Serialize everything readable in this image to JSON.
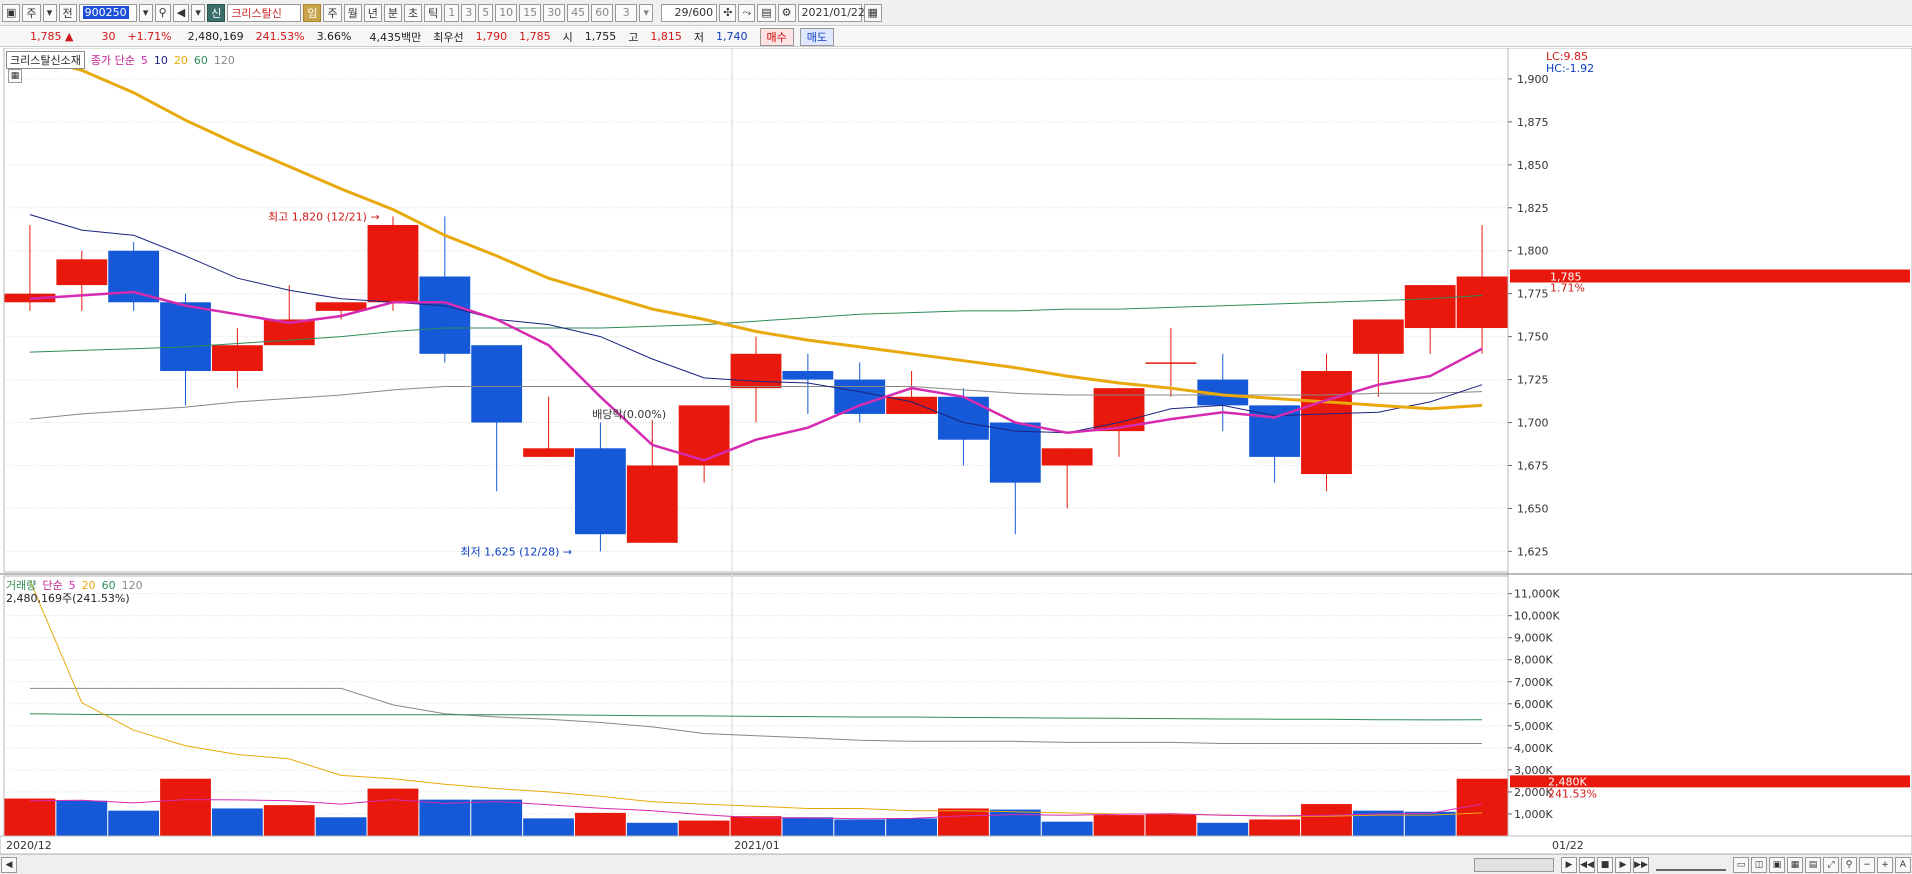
{
  "toolbar": {
    "market": "주",
    "scope": "전",
    "code": "900250",
    "symbol_badge": "신",
    "stock_name": "크리스탈신",
    "badge_gold": "임",
    "periods": [
      "주",
      "월",
      "년",
      "분",
      "초",
      "틱"
    ],
    "minutes": [
      "1",
      "3",
      "5",
      "10",
      "15",
      "30",
      "45",
      "60"
    ],
    "interval": "3",
    "count": "29/600",
    "date": "2021/01/22"
  },
  "quote": {
    "price": "1,785 ▲",
    "change": "30",
    "change_pct": "+1.71%",
    "volume": "2,480,169",
    "volume_pct": "241.53%",
    "turnover": "3.66%",
    "amount": "4,435백만",
    "best_label": "최우선",
    "best_ask": "1,790",
    "best_bid": "1,785",
    "open_label": "시",
    "open": "1,755",
    "high_label": "고",
    "high": "1,815",
    "low_label": "저",
    "low": "1,740",
    "buy_label": "매수",
    "sell_label": "매도"
  },
  "colors": {
    "up": "#e8180c",
    "down": "#1559d8",
    "ma5": "#d62bb0",
    "ma10": "#1a237e",
    "ma20": "#e8a90c",
    "ma60": "#2e8b57",
    "ma120": "#888888",
    "grid": "#dcdcdc",
    "axis_bg": "#ffffff"
  },
  "chart_data": [
    {
      "type": "candlestick",
      "legend": {
        "name": "크리스탈신소재",
        "ma_label": "종가 단순",
        "periods": [
          "5",
          "10",
          "20",
          "60",
          "120"
        ]
      },
      "y_ticks": [
        "1,900",
        "1,875",
        "1,850",
        "1,825",
        "1,800",
        "1,775",
        "1,750",
        "1,725",
        "1,700",
        "1,675",
        "1,650",
        "1,625"
      ],
      "ylim": [
        1613,
        1918
      ],
      "axis_labels": {
        "lc": "LC:9.85",
        "hc": "HC:-1.92",
        "current": "1,785",
        "current_pct": "1.71%"
      },
      "annotations": {
        "high": "최고 1,820 (12/21) →",
        "low": "최저 1,625 (12/28) →",
        "dividend": "배당락(0.00%)"
      },
      "x_labels": [
        "2020/12",
        "2021/01",
        "01/22"
      ],
      "candles": [
        {
          "o": 1770,
          "h": 1815,
          "l": 1765,
          "c": 1775
        },
        {
          "o": 1780,
          "h": 1800,
          "l": 1765,
          "c": 1795
        },
        {
          "o": 1800,
          "h": 1805,
          "l": 1765,
          "c": 1770
        },
        {
          "o": 1770,
          "h": 1775,
          "l": 1710,
          "c": 1730
        },
        {
          "o": 1730,
          "h": 1755,
          "l": 1720,
          "c": 1745
        },
        {
          "o": 1745,
          "h": 1780,
          "l": 1745,
          "c": 1760
        },
        {
          "o": 1765,
          "h": 1770,
          "l": 1760,
          "c": 1770
        },
        {
          "o": 1770,
          "h": 1820,
          "l": 1765,
          "c": 1815
        },
        {
          "o": 1785,
          "h": 1820,
          "l": 1735,
          "c": 1740
        },
        {
          "o": 1745,
          "h": 1745,
          "l": 1660,
          "c": 1700
        },
        {
          "o": 1680,
          "h": 1715,
          "l": 1680,
          "c": 1685
        },
        {
          "o": 1685,
          "h": 1700,
          "l": 1625,
          "c": 1635
        },
        {
          "o": 1630,
          "h": 1690,
          "l": 1630,
          "c": 1675
        },
        {
          "o": 1675,
          "h": 1710,
          "l": 1665,
          "c": 1710
        },
        {
          "o": 1720,
          "h": 1750,
          "l": 1700,
          "c": 1740
        },
        {
          "o": 1730,
          "h": 1740,
          "l": 1705,
          "c": 1725
        },
        {
          "o": 1725,
          "h": 1735,
          "l": 1700,
          "c": 1705
        },
        {
          "o": 1705,
          "h": 1730,
          "l": 1705,
          "c": 1715
        },
        {
          "o": 1715,
          "h": 1720,
          "l": 1675,
          "c": 1690
        },
        {
          "o": 1700,
          "h": 1700,
          "l": 1635,
          "c": 1665
        },
        {
          "o": 1675,
          "h": 1685,
          "l": 1650,
          "c": 1685
        },
        {
          "o": 1695,
          "h": 1720,
          "l": 1680,
          "c": 1720
        },
        {
          "o": 1735,
          "h": 1755,
          "l": 1715,
          "c": 1735
        },
        {
          "o": 1725,
          "h": 1740,
          "l": 1695,
          "c": 1710
        },
        {
          "o": 1710,
          "h": 1710,
          "l": 1665,
          "c": 1680
        },
        {
          "o": 1670,
          "h": 1740,
          "l": 1660,
          "c": 1730
        },
        {
          "o": 1740,
          "h": 1760,
          "l": 1715,
          "c": 1760
        },
        {
          "o": 1755,
          "h": 1780,
          "l": 1740,
          "c": 1780
        },
        {
          "o": 1755,
          "h": 1815,
          "l": 1740,
          "c": 1785
        }
      ],
      "ma5": [
        1772,
        1774,
        1776,
        1768,
        1763,
        1758,
        1762,
        1770,
        1770,
        1760,
        1745,
        1715,
        1687,
        1678,
        1690,
        1697,
        1710,
        1720,
        1715,
        1700,
        1694,
        1697,
        1702,
        1706,
        1703,
        1713,
        1722,
        1727,
        1743
      ],
      "ma10": [
        1821,
        1812,
        1809,
        1797,
        1784,
        1777,
        1772,
        1770,
        1768,
        1760,
        1757,
        1750,
        1737,
        1726,
        1724,
        1723,
        1718,
        1712,
        1700,
        1695,
        1694,
        1700,
        1708,
        1710,
        1704,
        1705,
        1706,
        1712,
        1722
      ],
      "ma20": [
        1913,
        1905,
        1892,
        1876,
        1862,
        1849,
        1836,
        1824,
        1809,
        1797,
        1784,
        1775,
        1766,
        1760,
        1753,
        1748,
        1744,
        1740,
        1736,
        1732,
        1727,
        1723,
        1720,
        1716,
        1714,
        1712,
        1710,
        1708,
        1710
      ],
      "ma60": [
        1741,
        1742,
        1743,
        1744,
        1746,
        1748,
        1750,
        1753,
        1755,
        1755,
        1755,
        1755,
        1756,
        1757,
        1759,
        1761,
        1763,
        1764,
        1765,
        1765,
        1766,
        1766,
        1767,
        1768,
        1769,
        1770,
        1771,
        1772,
        1774
      ],
      "ma120": [
        1702,
        1705,
        1707,
        1709,
        1712,
        1714,
        1716,
        1719,
        1721,
        1721,
        1721,
        1721,
        1721,
        1721,
        1721,
        1721,
        1721,
        1721,
        1719,
        1717,
        1716,
        1716,
        1716,
        1716,
        1716,
        1716,
        1717,
        1717,
        1718
      ]
    },
    {
      "type": "bar",
      "legend": {
        "name": "거래량",
        "ma_label": "단순",
        "periods": [
          "5",
          "20",
          "60",
          "120"
        ],
        "info": "2,480,169주(241.53%)"
      },
      "y_ticks": [
        "11,000K",
        "10,000K",
        "9,000K",
        "8,000K",
        "7,000K",
        "6,000K",
        "5,000K",
        "4,000K",
        "3,000K",
        "2,000K",
        "1,000K"
      ],
      "ylim": [
        0,
        11800
      ],
      "axis_labels": {
        "current": "2,480K",
        "current_pct": "241.53%"
      },
      "values": [
        1700,
        1600,
        1150,
        2600,
        1250,
        1400,
        850,
        2150,
        1650,
        1650,
        800,
        1050,
        600,
        700,
        900,
        850,
        750,
        800,
        1250,
        1200,
        650,
        950,
        1000,
        600,
        750,
        1450,
        1150,
        1100,
        2600
      ],
      "up": [
        true,
        false,
        false,
        true,
        false,
        true,
        false,
        true,
        false,
        false,
        false,
        true,
        false,
        true,
        true,
        false,
        false,
        false,
        true,
        false,
        false,
        true,
        true,
        false,
        true,
        true,
        false,
        false,
        true
      ],
      "ma5": [
        1600,
        1620,
        1500,
        1650,
        1640,
        1600,
        1450,
        1650,
        1480,
        1560,
        1420,
        1260,
        1150,
        960,
        820,
        820,
        780,
        800,
        910,
        970,
        940,
        990,
        1010,
        940,
        910,
        940,
        1000,
        1030,
        1450
      ],
      "ma20": [
        11600,
        6050,
        4800,
        4100,
        3700,
        3500,
        2750,
        2600,
        2350,
        2150,
        2000,
        1800,
        1550,
        1450,
        1350,
        1250,
        1250,
        1150,
        1150,
        1100,
        1050,
        1000,
        1000,
        950,
        900,
        900,
        950,
        950,
        1050
      ],
      "ma60": [
        5550,
        5520,
        5500,
        5500,
        5500,
        5500,
        5500,
        5500,
        5500,
        5500,
        5500,
        5480,
        5460,
        5450,
        5430,
        5420,
        5400,
        5400,
        5380,
        5370,
        5350,
        5340,
        5330,
        5310,
        5300,
        5300,
        5280,
        5270,
        5280
      ],
      "ma120": [
        6700,
        6700,
        6700,
        6700,
        6700,
        6700,
        6700,
        5950,
        5550,
        5400,
        5300,
        5150,
        4950,
        4650,
        4550,
        4450,
        4350,
        4300,
        4300,
        4300,
        4250,
        4250,
        4250,
        4200,
        4200,
        4200,
        4200,
        4200,
        4200
      ]
    }
  ]
}
